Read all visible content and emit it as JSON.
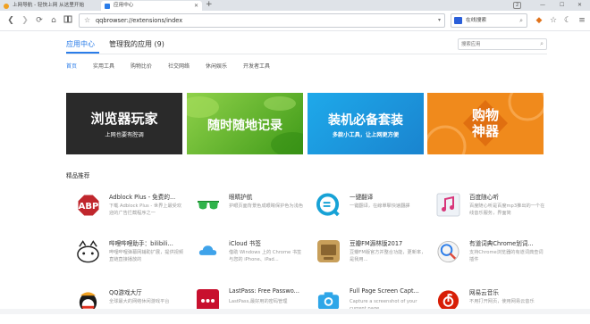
{
  "browser": {
    "tabs": [
      {
        "label": "上网导航 - 轻快上网 从这里开始",
        "favicon_color": "#f0a020"
      },
      {
        "label": "应用中心",
        "favicon_color": "#2b7de9"
      }
    ],
    "new_tab_icon": "plus-icon",
    "window_controls": {
      "badge": "2"
    },
    "url": "qqbrowser://extensions/index",
    "search_engine_label": "在线搜索"
  },
  "page": {
    "nav_tabs": [
      {
        "label": "应用中心"
      },
      {
        "label": "管理我的应用 (9)"
      }
    ],
    "search_placeholder": "搜索应用",
    "categories": [
      {
        "label": "首页"
      },
      {
        "label": "实用工具"
      },
      {
        "label": "购物比价"
      },
      {
        "label": "社交网络"
      },
      {
        "label": "休闲娱乐"
      },
      {
        "label": "开发者工具"
      }
    ],
    "banners": [
      {
        "title": "浏览器玩家",
        "subtitle": "上网也要有腔调",
        "bg": "#2a2a2a"
      },
      {
        "title": "随时随地记录",
        "subtitle": "",
        "bg": "#6cbf2a"
      },
      {
        "title": "装机必备套装",
        "subtitle": "多款小工具，让上网更方便",
        "bg": "#1a97d8"
      },
      {
        "title": "购物 神器",
        "subtitle": "",
        "bg": "#f08a1c"
      }
    ],
    "section_title": "精品推荐",
    "apps": [
      {
        "name": "Adblock Plus - 免费的...",
        "desc": "下载 Adblock Plus - 世界上最受欢迎的广告拦截程序之一",
        "icon": "adblock-icon"
      },
      {
        "name": "眼睛护航",
        "desc": "护眼页面背景色成眼睛保护色为浅色",
        "icon": "eye-glasses-icon"
      },
      {
        "name": "一键翻译",
        "desc": "一键翻译，在線單擊快速翻譯",
        "icon": "translate-icon"
      },
      {
        "name": "百度随心听",
        "desc": "百度随心听是百度mp3推出的一个在线音乐服务，界面简",
        "icon": "baidu-music-icon"
      },
      {
        "name": "哔哩哔哩助手：bilibili...",
        "desc": "哔哩哔哩弹幕网辅助扩展，提供视频直链直接播放的",
        "icon": "bilibili-icon"
      },
      {
        "name": "iCloud 书签",
        "desc": "借助 Windows 上的 Chrome 书签与您的 iPhone、iPad...",
        "icon": "icloud-icon"
      },
      {
        "name": "豆瓣FM源林版2017",
        "desc": "豆瓣FM版官方并整合功能，更新率，是我用...",
        "icon": "douban-fm-icon"
      },
      {
        "name": "有道词典Chrome划词...",
        "desc": "支持Chrome浏览器的有道词典查词插件",
        "icon": "youdao-icon"
      },
      {
        "name": "QQ游戏大厅",
        "desc": "全球最大的网络休闲游戏平台",
        "icon": "qq-game-icon"
      },
      {
        "name": "LastPass: Free Passwo...",
        "desc": "LastPass,最好用的密码管理",
        "icon": "lastpass-icon"
      },
      {
        "name": "Full Page Screen Capt...",
        "desc": "Capture a screenshot of your current page",
        "icon": "camera-icon"
      },
      {
        "name": "网易云音乐",
        "desc": "不用打开网页，使用网易云音乐",
        "icon": "netease-music-icon"
      }
    ]
  },
  "colors": {
    "accent": "#2b7de9"
  }
}
